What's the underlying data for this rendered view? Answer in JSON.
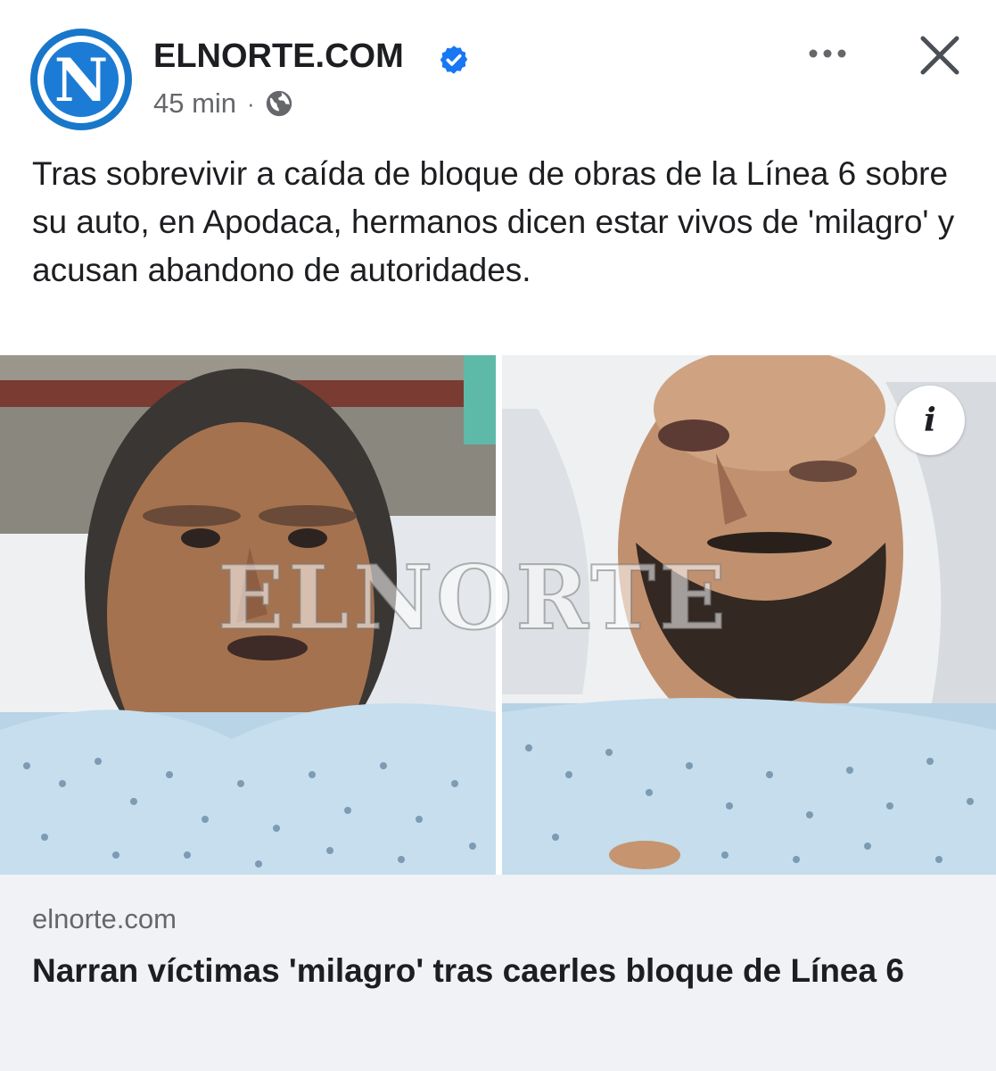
{
  "post": {
    "page_name": "ELNORTE.COM",
    "avatar_letter": "N",
    "verified": true,
    "time": "45 min",
    "separator": "·",
    "audience_icon": "globe-icon",
    "text": "Tras sobrevivir a caída de bloque de obras de la Línea 6 sobre su auto, en Apodaca, hermanos dicen estar vivos de 'milagro' y acusan abandono de autoridades.",
    "more_icon": "more-horizontal-icon",
    "close_icon": "close-icon"
  },
  "media": {
    "watermark": "ELNORTE",
    "info_label": "i"
  },
  "link_preview": {
    "domain": "elnorte.com",
    "title": "Narran víctimas 'milagro' tras caerles bloque de Línea 6"
  },
  "colors": {
    "brand_blue": "#1877c9",
    "verified_blue": "#1877f2",
    "meta_gray": "#65676b",
    "card_bg": "#f0f2f5"
  }
}
